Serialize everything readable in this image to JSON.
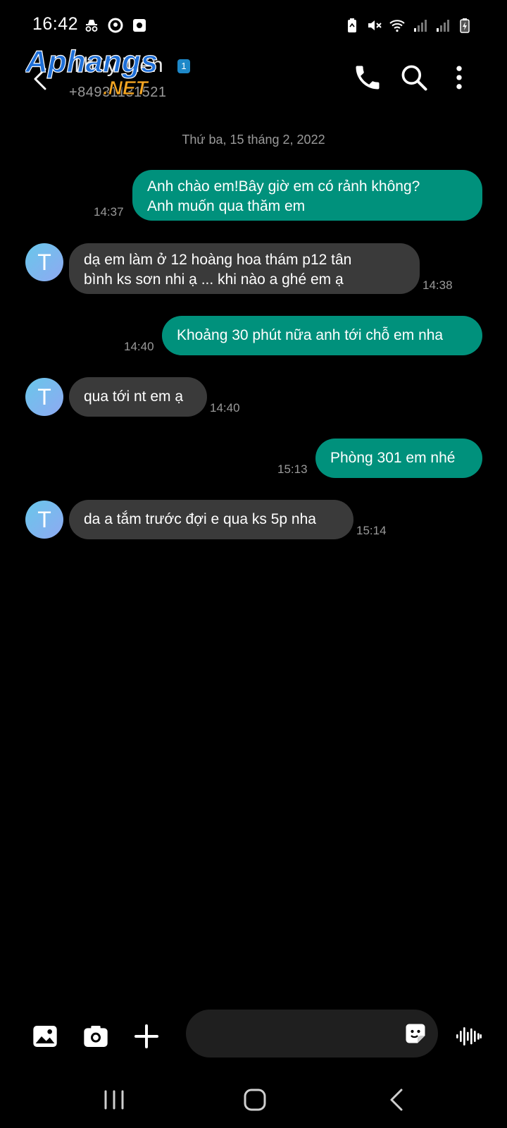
{
  "status_bar": {
    "time": "16:42",
    "icons_left": [
      "incognito-icon",
      "location-ring-icon",
      "notification-icon"
    ],
    "icons_right": [
      "battery-saver-icon",
      "mute-icon",
      "wifi-icon",
      "signal-1-icon",
      "signal-2-icon",
      "battery-charging-icon"
    ]
  },
  "header": {
    "contact_name": "Thùy Tiên",
    "contact_number": "+84931131521",
    "badge": "1",
    "watermark_top": "Aphangs",
    "watermark_bottom": ".NET"
  },
  "conversation": {
    "date": "Thứ ba, 15 tháng 2, 2022",
    "avatar_letter": "T",
    "messages": [
      {
        "direction": "out",
        "lines": [
          "Anh chào em!Bây giờ em có rảnh không?",
          "Anh muốn qua thăm em"
        ],
        "time": "14:37"
      },
      {
        "direction": "in",
        "lines": [
          "dạ em làm ở 12 hoàng hoa thám p12 tân",
          "bình ks sơn nhi ạ ... khi nào a ghé em ạ"
        ],
        "time": "14:38"
      },
      {
        "direction": "out",
        "lines": [
          "Khoảng 30 phút nữa anh tới chỗ em nha"
        ],
        "time": "14:40"
      },
      {
        "direction": "in",
        "lines": [
          "qua tới nt em ạ"
        ],
        "time": "14:40"
      },
      {
        "direction": "out",
        "lines": [
          "Phòng 301 em nhé"
        ],
        "time": "15:13"
      },
      {
        "direction": "in",
        "lines": [
          "da a tắm trước đợi e qua ks 5p nha"
        ],
        "time": "15:14"
      }
    ]
  },
  "composer": {
    "placeholder": "",
    "buttons": [
      "gallery-icon",
      "camera-icon",
      "plus-icon",
      "sticker-icon",
      "voice-icon"
    ]
  },
  "colors": {
    "outgoing": "#00917c",
    "incoming": "#3a3a3a",
    "background": "#000000"
  }
}
